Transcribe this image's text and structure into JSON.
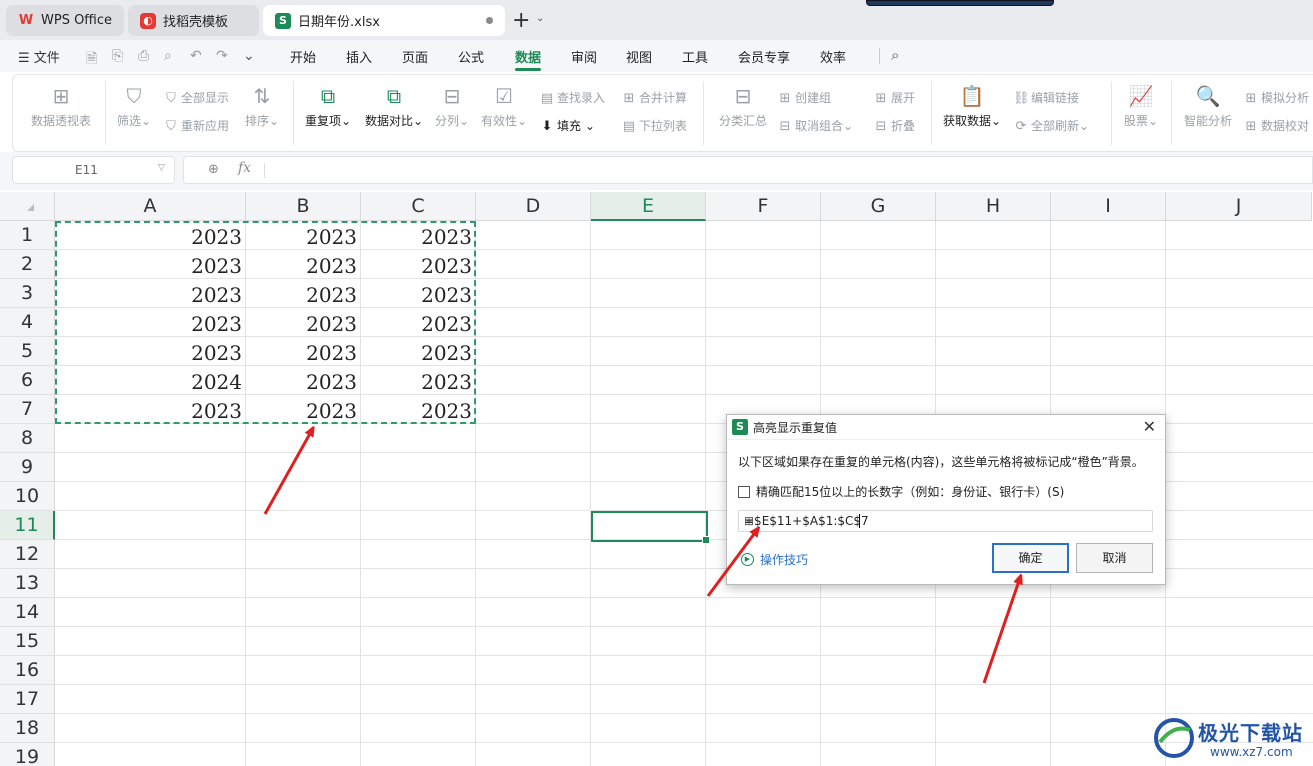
{
  "tabs": {
    "wps": "WPS Office",
    "template": "找稻壳模板",
    "file": "日期年份.xlsx",
    "file_icon": "S"
  },
  "menu": {
    "file": "文件",
    "items": [
      "开始",
      "插入",
      "页面",
      "公式",
      "数据",
      "审阅",
      "视图",
      "工具",
      "会员专享",
      "效率"
    ],
    "active": "数据"
  },
  "ribbon": {
    "pivot": "数据透视表",
    "filter": "筛选",
    "show_all": "全部显示",
    "reapply": "重新应用",
    "sort": "排序",
    "duplicates": "重复项",
    "compare": "数据对比",
    "split": "分列",
    "validity": "有效性",
    "lookup_entry": "查找录入",
    "fill": "填充",
    "merge_calc": "合并计算",
    "dropdown": "下拉列表",
    "subtotal": "分类汇总",
    "create_group": "创建组",
    "ungroup": "取消组合",
    "expand": "展开",
    "collapse": "折叠",
    "get_data": "获取数据",
    "edit_links": "编辑链接",
    "refresh_all": "全部刷新",
    "stocks": "股票",
    "smart_analysis": "智能分析",
    "simulate": "模拟分析",
    "data_check": "数据校对"
  },
  "formula_bar": {
    "cell_ref": "E11",
    "fx": "fx"
  },
  "grid": {
    "columns": [
      "A",
      "B",
      "C",
      "D",
      "E",
      "F",
      "G",
      "H",
      "I",
      "J"
    ],
    "rows": [
      "1",
      "2",
      "3",
      "4",
      "5",
      "6",
      "7",
      "8",
      "9",
      "10",
      "11",
      "12",
      "13",
      "14",
      "15",
      "16",
      "17",
      "18",
      "19"
    ],
    "selected_column": "E",
    "selected_row": "11",
    "data": [
      [
        "2023",
        "2023",
        "2023"
      ],
      [
        "2023",
        "2023",
        "2023"
      ],
      [
        "2023",
        "2023",
        "2023"
      ],
      [
        "2023",
        "2023",
        "2023"
      ],
      [
        "2023",
        "2023",
        "2023"
      ],
      [
        "2024",
        "2023",
        "2023"
      ],
      [
        "2023",
        "2023",
        "2023"
      ]
    ]
  },
  "dialog": {
    "icon": "S",
    "title": "高亮显示重复值",
    "description": "以下区域如果存在重复的单元格(内容)，这些单元格将被标记成“橙色”背景。",
    "checkbox_label": "精确匹配15位以上的长数字（例如：身份证、银行卡）(S)",
    "range_value": "=$E$11+$A$1:$C$7",
    "tips": "操作技巧",
    "ok": "确定",
    "cancel": "取消"
  },
  "watermark": {
    "name": "极光下载站",
    "url": "www.xz7.com"
  },
  "colors": {
    "accent": "#1e8b57",
    "arrow": "#e02020",
    "link": "#2a6fc9"
  }
}
